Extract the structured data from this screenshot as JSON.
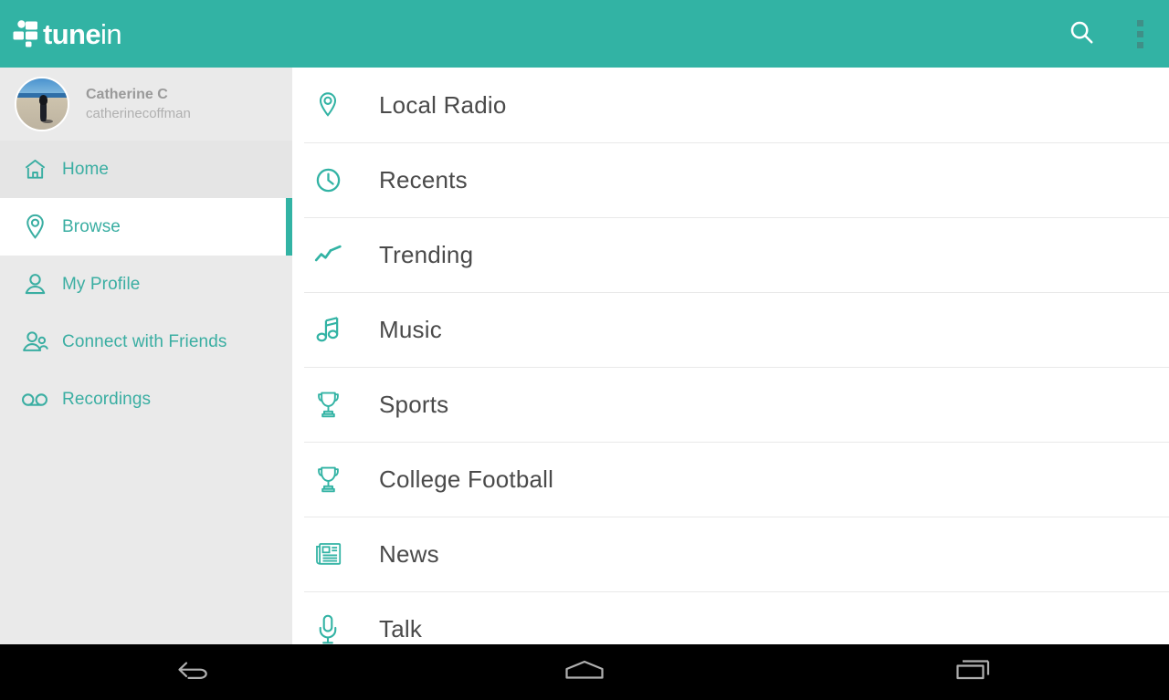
{
  "header": {
    "logo_text_bold": "tune",
    "logo_text_light": "in",
    "logo_icon": "tunein-logo-icon",
    "search_icon": "search-icon",
    "overflow_icon": "overflow-menu-icon",
    "background_color": "#32b3a4"
  },
  "sidebar": {
    "background_color": "#eaeaea",
    "accent_color": "#32b3a4",
    "profile": {
      "name": "Catherine C",
      "handle": "catherinecoffman",
      "avatar_icon": "user-avatar-photo"
    },
    "items": [
      {
        "label": "Home",
        "icon": "home-icon",
        "state": "highlighted"
      },
      {
        "label": "Browse",
        "icon": "location-pin-icon",
        "state": "selected"
      },
      {
        "label": "My Profile",
        "icon": "person-icon",
        "state": "normal"
      },
      {
        "label": "Connect with Friends",
        "icon": "people-group-icon",
        "state": "normal"
      },
      {
        "label": "Recordings",
        "icon": "voicemail-icon",
        "state": "normal"
      }
    ]
  },
  "main": {
    "text_color": "#4a4a4a",
    "icon_color": "#32b3a4",
    "rows": [
      {
        "label": "Local Radio",
        "icon": "location-pin-icon"
      },
      {
        "label": "Recents",
        "icon": "clock-icon"
      },
      {
        "label": "Trending",
        "icon": "trending-up-icon"
      },
      {
        "label": "Music",
        "icon": "music-note-icon"
      },
      {
        "label": "Sports",
        "icon": "trophy-icon"
      },
      {
        "label": "College Football",
        "icon": "trophy-icon"
      },
      {
        "label": "News",
        "icon": "newspaper-icon"
      },
      {
        "label": "Talk",
        "icon": "microphone-icon"
      }
    ]
  },
  "navbar": {
    "background_color": "#000000",
    "back_icon": "back-arrow-icon",
    "home_icon": "home-pentagon-icon",
    "recents_icon": "recent-apps-icon"
  }
}
